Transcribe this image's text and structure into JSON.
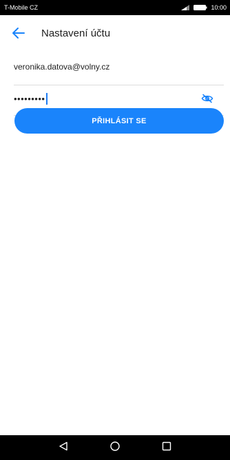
{
  "status_bar": {
    "carrier": "T-Mobile CZ",
    "time": "10:00",
    "icons": [
      "signal-icon",
      "battery-icon"
    ]
  },
  "app_bar": {
    "back_icon": "arrow-left-icon",
    "title": "Nastavení účtu"
  },
  "form": {
    "email_value": "veronika.datova@volny.cz",
    "password_mask": "•••••••••",
    "password_toggle_icon": "eye-off-icon",
    "login_label": "PŘIHLÁSIT SE"
  },
  "nav_bar": {
    "buttons": [
      "back-triangle-icon",
      "home-circle-icon",
      "recents-square-icon"
    ]
  },
  "colors": {
    "accent": "#1a84fb",
    "status_bar_bg": "#000000",
    "divider": "#dcdcdc"
  }
}
